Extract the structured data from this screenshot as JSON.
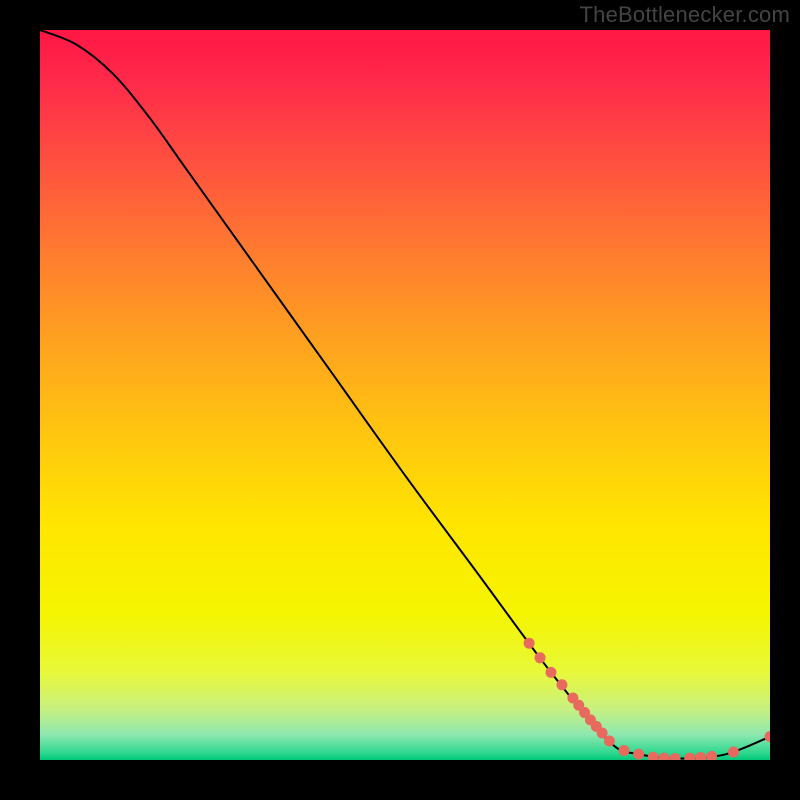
{
  "attribution": "TheBottlenecker.com",
  "chart_data": {
    "type": "line",
    "title": "",
    "xlabel": "",
    "ylabel": "",
    "xlim": [
      0,
      100
    ],
    "ylim": [
      0,
      100
    ],
    "curve": [
      {
        "x": 0,
        "y": 100
      },
      {
        "x": 5,
        "y": 98
      },
      {
        "x": 10,
        "y": 94
      },
      {
        "x": 15,
        "y": 88
      },
      {
        "x": 20,
        "y": 81
      },
      {
        "x": 30,
        "y": 67
      },
      {
        "x": 40,
        "y": 53
      },
      {
        "x": 50,
        "y": 39
      },
      {
        "x": 60,
        "y": 25.5
      },
      {
        "x": 70,
        "y": 12
      },
      {
        "x": 78,
        "y": 2.5
      },
      {
        "x": 82,
        "y": 0.8
      },
      {
        "x": 88,
        "y": 0.2
      },
      {
        "x": 94,
        "y": 0.8
      },
      {
        "x": 100,
        "y": 3.2
      }
    ],
    "markers": [
      {
        "x": 67,
        "y": 16
      },
      {
        "x": 68.5,
        "y": 14
      },
      {
        "x": 70,
        "y": 12
      },
      {
        "x": 71.5,
        "y": 10.3
      },
      {
        "x": 73,
        "y": 8.5
      },
      {
        "x": 73.8,
        "y": 7.5
      },
      {
        "x": 74.6,
        "y": 6.5
      },
      {
        "x": 75.4,
        "y": 5.5
      },
      {
        "x": 76.2,
        "y": 4.6
      },
      {
        "x": 77,
        "y": 3.7
      },
      {
        "x": 78,
        "y": 2.6
      },
      {
        "x": 80,
        "y": 1.3
      },
      {
        "x": 82,
        "y": 0.8
      },
      {
        "x": 84,
        "y": 0.4
      },
      {
        "x": 85.5,
        "y": 0.25
      },
      {
        "x": 87,
        "y": 0.2
      },
      {
        "x": 89,
        "y": 0.25
      },
      {
        "x": 90.5,
        "y": 0.35
      },
      {
        "x": 92,
        "y": 0.5
      },
      {
        "x": 95,
        "y": 1.1
      },
      {
        "x": 100,
        "y": 3.2
      }
    ],
    "marker_color": "#e86a5e",
    "curve_color": "#000000",
    "gradient_stops": [
      {
        "offset": 0,
        "color": "#ff1744"
      },
      {
        "offset": 0.07,
        "color": "#ff2a4a"
      },
      {
        "offset": 0.18,
        "color": "#ff5040"
      },
      {
        "offset": 0.3,
        "color": "#ff7a30"
      },
      {
        "offset": 0.42,
        "color": "#ffa020"
      },
      {
        "offset": 0.55,
        "color": "#ffc510"
      },
      {
        "offset": 0.68,
        "color": "#ffe600"
      },
      {
        "offset": 0.8,
        "color": "#f5f500"
      },
      {
        "offset": 0.88,
        "color": "#e8f83a"
      },
      {
        "offset": 0.93,
        "color": "#c8f080"
      },
      {
        "offset": 0.965,
        "color": "#8ee8b0"
      },
      {
        "offset": 0.99,
        "color": "#30d890"
      },
      {
        "offset": 1.0,
        "color": "#00c878"
      }
    ]
  }
}
